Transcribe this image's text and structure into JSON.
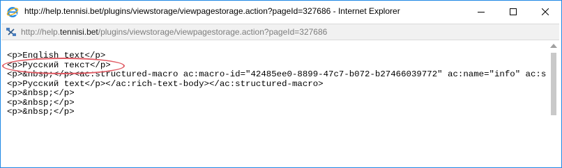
{
  "window": {
    "title": "http://help.tennisi.bet/plugins/viewstorage/viewpagestorage.action?pageId=327686 - Internet Explorer",
    "icon": "ie-icon",
    "controls": [
      "minimize-icon",
      "maximize-icon",
      "close-icon"
    ]
  },
  "address_bar": {
    "icon": "ie-page-icon",
    "url_prefix": "http://help.",
    "url_host": "tennisi.bet",
    "url_path": "/plugins/viewstorage/viewpagestorage.action?pageId=327686"
  },
  "content": {
    "lines": [
      "<p>English text</p>",
      "<p>Русский текст</p>",
      "<p>&nbsp;</p><ac:structured-macro ac:macro-id=\"42485ee0-8899-47c7-b072-b27466039772\" ac:name=\"info\" ac:s",
      "<p>Русский text</p></ac:rich-text-body></ac:structured-macro>",
      "<p>&nbsp;</p>",
      "<p>&nbsp;</p>",
      "<p>&nbsp;</p>"
    ],
    "highlight_color": "#e05a63"
  },
  "colors": {
    "window_border": "#1e88e5",
    "address_bg": "#f1f1f1"
  }
}
